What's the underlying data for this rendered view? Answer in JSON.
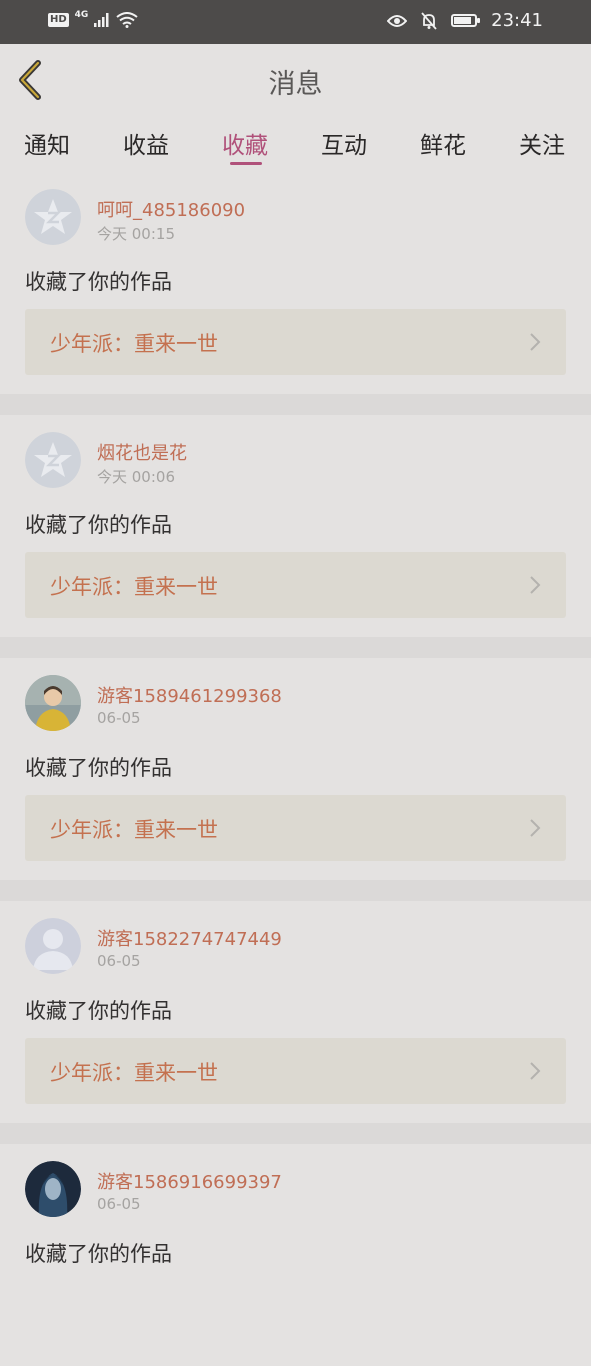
{
  "status_bar": {
    "hd": "HD",
    "network": "4G",
    "time": "23:41",
    "battery_level": 0.75,
    "icons": [
      "signal-icon",
      "wifi-icon",
      "eye-icon",
      "bell-off-icon",
      "battery-icon"
    ]
  },
  "nav": {
    "title": "消息",
    "back_icon": "chevron-left-icon"
  },
  "tabs": [
    {
      "label": "通知",
      "active": false
    },
    {
      "label": "收益",
      "active": false
    },
    {
      "label": "收藏",
      "active": true
    },
    {
      "label": "互动",
      "active": false
    },
    {
      "label": "鲜花",
      "active": false
    },
    {
      "label": "关注",
      "active": false
    }
  ],
  "messages": [
    {
      "username": "呵呵_485186090",
      "time": "今天 00:15",
      "action": "收藏了你的作品",
      "work": "少年派：重来一世",
      "avatar": "default-star-avatar"
    },
    {
      "username": "烟花也是花",
      "time": "今天 00:06",
      "action": "收藏了你的作品",
      "work": "少年派：重来一世",
      "avatar": "default-star-avatar"
    },
    {
      "username": "游客1589461299368",
      "time": "06-05",
      "action": "收藏了你的作品",
      "work": "少年派：重来一世",
      "avatar": "photo-avatar-yellow"
    },
    {
      "username": "游客1582274747449",
      "time": "06-05",
      "action": "收藏了你的作品",
      "work": "少年派：重来一世",
      "avatar": "default-person-avatar"
    },
    {
      "username": "游客1586916699397",
      "time": "06-05",
      "action": "收藏了你的作品",
      "work": "",
      "avatar": "photo-avatar-dark"
    }
  ],
  "colors": {
    "accent": "#b0517a",
    "username": "#c06e55",
    "work_title": "#c4714f",
    "background": "#e4e2e1",
    "status_bar": "#4d4b4a"
  }
}
